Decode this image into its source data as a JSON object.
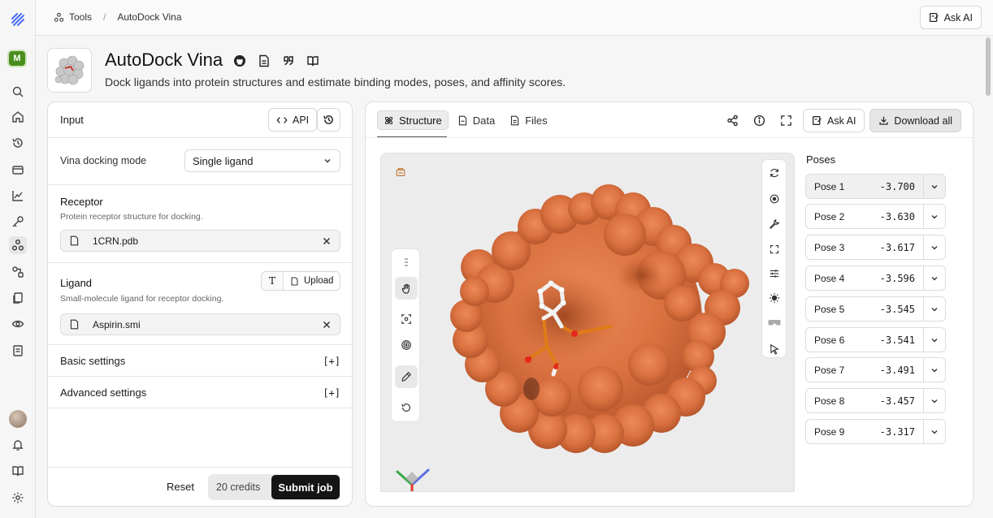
{
  "breadcrumb": {
    "parent": "Tools",
    "separator": "/",
    "current": "AutoDock Vina"
  },
  "topbar": {
    "ask_ai": "Ask AI"
  },
  "rail": {
    "org_initial": "M"
  },
  "tool": {
    "title": "AutoDock Vina",
    "description": "Dock ligands into protein structures and estimate binding modes, poses, and affinity scores."
  },
  "input": {
    "title": "Input",
    "api_label": "API",
    "mode_label": "Vina docking mode",
    "mode_value": "Single ligand",
    "receptor": {
      "title": "Receptor",
      "description": "Protein receptor structure for docking.",
      "file": "1CRN.pdb"
    },
    "ligand": {
      "title": "Ligand",
      "description": "Small-molecule ligand for receptor docking.",
      "file": "Aspirin.smi",
      "text_toggle": "T",
      "upload_label": "Upload"
    },
    "basic_settings": "Basic settings",
    "advanced_settings": "Advanced settings",
    "expand_symbol": "[+]",
    "reset": "Reset",
    "credits": "20 credits",
    "submit": "Submit job"
  },
  "output": {
    "tabs": [
      {
        "label": "Structure",
        "active": true
      },
      {
        "label": "Data",
        "active": false
      },
      {
        "label": "Files",
        "active": false
      }
    ],
    "ask_ai": "Ask AI",
    "download_all": "Download all",
    "poses_title": "Poses",
    "poses": [
      {
        "label": "Pose 1",
        "score": "-3.700",
        "selected": true
      },
      {
        "label": "Pose 2",
        "score": "-3.630"
      },
      {
        "label": "Pose 3",
        "score": "-3.617"
      },
      {
        "label": "Pose 4",
        "score": "-3.596"
      },
      {
        "label": "Pose 5",
        "score": "-3.545"
      },
      {
        "label": "Pose 6",
        "score": "-3.541"
      },
      {
        "label": "Pose 7",
        "score": "-3.491"
      },
      {
        "label": "Pose 8",
        "score": "-3.457"
      },
      {
        "label": "Pose 9",
        "score": "-3.317"
      }
    ]
  },
  "colors": {
    "surface": "#d9703f",
    "ligand_carbon": "#f2f2f2",
    "ligand_oxygen": "#e4281a",
    "ligand_bond": "#e07b17",
    "org_badge": "#4a8f1e"
  }
}
